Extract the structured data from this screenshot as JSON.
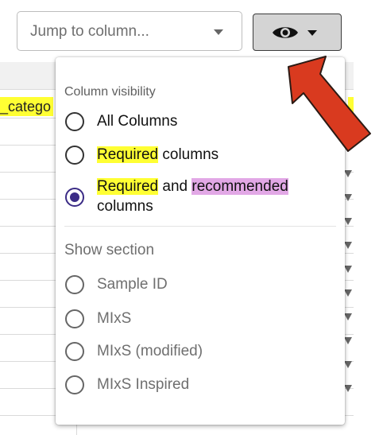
{
  "jump_to_column": {
    "placeholder": "Jump to column..."
  },
  "visibility_button": {
    "icon": "eye-icon",
    "caret_icon": "caret-down-icon"
  },
  "grid": {
    "visible_column_header": "_catego"
  },
  "menu": {
    "column_visibility": {
      "heading": "Column visibility",
      "options": [
        {
          "label": "All Columns",
          "selected": false
        },
        {
          "highlight": "Required",
          "rest": " columns",
          "selected": false
        },
        {
          "highlight1": "Required",
          "middle": " and ",
          "highlight2": "recommended",
          "line2": "columns",
          "selected": true
        }
      ]
    },
    "show_section": {
      "heading": "Show section",
      "options": [
        {
          "label": "Sample ID"
        },
        {
          "label": "MIxS"
        },
        {
          "label": "MIxS (modified)"
        },
        {
          "label": "MIxS Inspired"
        }
      ]
    }
  },
  "colors": {
    "highlight_yellow": "#ffff33",
    "highlight_pink": "#e2a8e6",
    "radio_selected": "#3b2c86",
    "annotation_arrow": "#d93a1f"
  }
}
